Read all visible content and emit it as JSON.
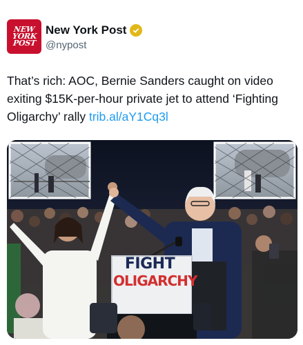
{
  "account": {
    "avatar_lines": [
      "NEW",
      "YORK",
      "POST"
    ],
    "display_name": "New York Post",
    "handle": "@nypost",
    "verified_icon": "gold-verified-badge-icon",
    "colors": {
      "brand_red": "#c8102e",
      "badge_gold": "#e2b719"
    }
  },
  "tweet": {
    "text": "That’s rich: AOC, Bernie Sanders caught on video exiting $15K-per-hour private jet to attend ‘Fighting Oligarchy’ rally ",
    "link": "trib.al/aY1Cq3l",
    "link_color": "#1d9bf0"
  },
  "media": {
    "sign_line1": "FIGHT",
    "sign_line2": "OLIGARCHY"
  }
}
